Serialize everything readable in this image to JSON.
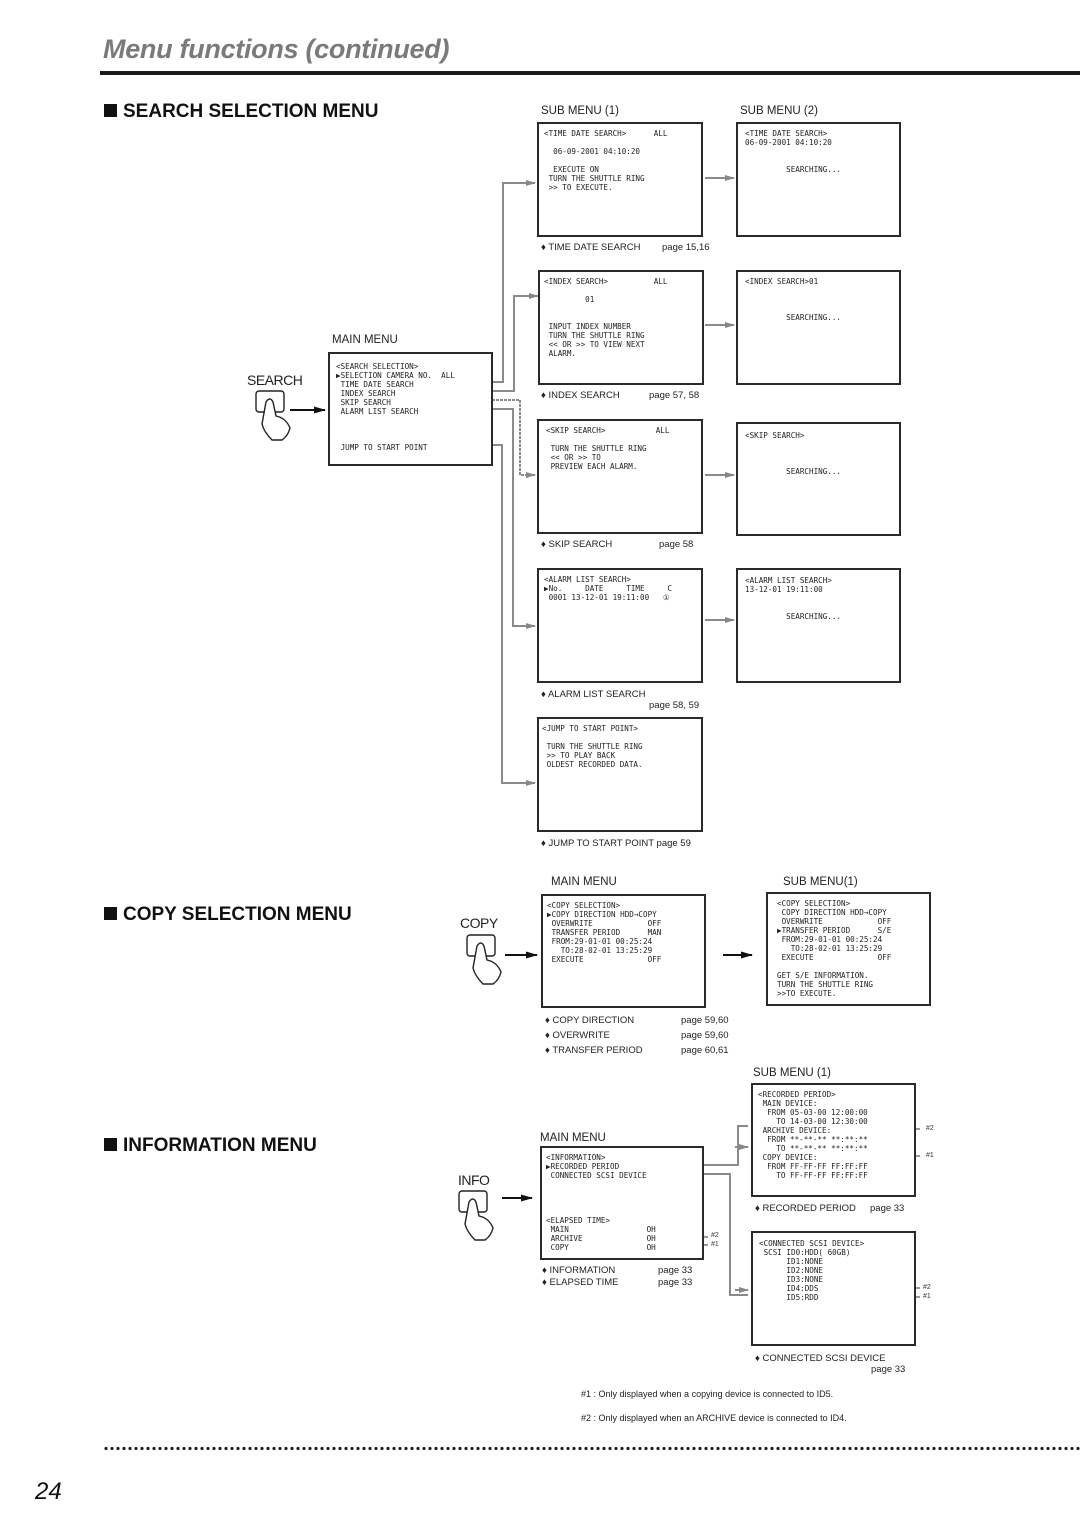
{
  "header": {
    "title": "Menu functions (continued)"
  },
  "search_section": {
    "heading": "SEARCH SELECTION MENU",
    "button_label": "SEARCH",
    "main_menu_label": "MAIN MENU",
    "sub_menu1_label": "SUB MENU (1)",
    "sub_menu2_label": "SUB MENU (2)",
    "main_screen": "<SEARCH SELECTION>\n▶SELECTION CAMERA NO.  ALL\n TIME DATE SEARCH\n INDEX SEARCH\n SKIP SEARCH\n ALARM LIST SEARCH\n\n\n\n JUMP TO START POINT",
    "time_date": {
      "sub1": "<TIME DATE SEARCH>      ALL\n\n  06-09-2001 04:10:20\n\n  EXECUTE ON\n TURN THE SHUTTLE RING\n >> TO EXECUTE.",
      "sub2": "<TIME DATE SEARCH>\n06-09-2001 04:10:20\n\n\n         SEARCHING...",
      "ref_label": "♦ TIME DATE SEARCH",
      "ref_page": "page 15,16"
    },
    "index": {
      "sub1": "<INDEX SEARCH>          ALL\n\n         01\n\n\n INPUT INDEX NUMBER\n TURN THE SHUTTLE RING\n << OR >> TO VIEW NEXT\n ALARM.",
      "sub2": "<INDEX SEARCH>01\n\n\n\n         SEARCHING...",
      "ref_label": "♦ INDEX SEARCH",
      "ref_page": "page 57, 58"
    },
    "skip": {
      "sub1": "<SKIP SEARCH>           ALL\n\n TURN THE SHUTTLE RING\n << OR >> TO\n PREVIEW EACH ALARM.",
      "sub2": "<SKIP SEARCH>\n\n\n\n         SEARCHING...",
      "ref_label": "♦ SKIP SEARCH",
      "ref_page": "page 58"
    },
    "alarm_list": {
      "sub1": "<ALARM LIST SEARCH>\n▶No.     DATE     TIME     C\n 0001 13-12-01 19:11:00   ①",
      "sub2": "<ALARM LIST SEARCH>\n13-12-01 19:11:00\n\n\n         SEARCHING...",
      "ref_label": "♦ ALARM LIST SEARCH",
      "ref_page": "page 58, 59"
    },
    "jump": {
      "sub1": "<JUMP TO START POINT>\n\n TURN THE SHUTTLE RING\n >> TO PLAY BACK\n OLDEST RECORDED DATA.",
      "ref_label": "♦ JUMP TO START POINT page 59"
    }
  },
  "copy_section": {
    "heading": "COPY SELECTION MENU",
    "button_label": "COPY",
    "main_menu_label": "MAIN MENU",
    "sub_menu_label": "SUB MENU(1)",
    "main_screen": "<COPY SELECTION>\n▶COPY DIRECTION HDD→COPY\n OVERWRITE            OFF\n TRANSFER PERIOD      MAN\n FROM:29-01-01 00:25:24\n   TO:28-02-01 13:25:29\n EXECUTE              OFF",
    "sub_screen": "<COPY SELECTION>\n COPY DIRECTION HDD→COPY\n OVERWRITE            OFF\n▶TRANSFER PERIOD      S/E\n FROM:29-01-01 00:25:24\n   TO:28-02-01 13:25:29\n EXECUTE              OFF\n\nGET S/E INFORMATION.\nTURN THE SHUTTLE RING\n>>TO EXECUTE.",
    "refs": [
      {
        "label": "♦ COPY DIRECTION",
        "page": "page 59,60"
      },
      {
        "label": "♦ OVERWRITE",
        "page": "page 59,60"
      },
      {
        "label": "♦ TRANSFER PERIOD",
        "page": "page 60,61"
      }
    ]
  },
  "info_section": {
    "heading": "INFORMATION MENU",
    "button_label": "INFO",
    "main_menu_label": "MAIN MENU",
    "sub_menu_label": "SUB MENU (1)",
    "main_screen": "<INFORMATION>\n▶RECORDED PERIOD\n CONNECTED SCSI DEVICE\n\n\n\n\n<ELAPSED TIME>\n MAIN                 OH\n ARCHIVE              OH\n COPY                 OH",
    "recorded_period_screen": "<RECORDED PERIOD>\n MAIN DEVICE:\n  FROM 05-03-00 12:00:00\n    TO 14-03-00 12:30:00\n ARCHIVE DEVICE:\n  FROM **-**-** **:**:**\n    TO **-**-** **:**:**\n COPY DEVICE:\n  FROM FF-FF-FF FF:FF:FF\n    TO FF-FF-FF FF:FF:FF",
    "scsi_screen": "<CONNECTED SCSI DEVICE>\n SCSI ID0:HDD( 60GB)\n      ID1:NONE\n      ID2:NONE\n      ID3:NONE\n      ID4:DDS\n      ID5:RDD",
    "refs": [
      {
        "label": "♦ INFORMATION",
        "page": "page 33"
      },
      {
        "label": "♦ ELAPSED TIME",
        "page": "page 33"
      }
    ],
    "recorded_ref": {
      "label": "♦ RECORDED PERIOD",
      "page": "page 33"
    },
    "scsi_ref": {
      "label": "♦ CONNECTED SCSI DEVICE",
      "page": "page 33"
    },
    "markers": {
      "one": "#1",
      "two": "#2"
    }
  },
  "footnotes": [
    "#1 : Only displayed when a copying device is connected to ID5.",
    "#2 : Only displayed when an ARCHIVE device is connected to ID4."
  ],
  "page_number": "24"
}
